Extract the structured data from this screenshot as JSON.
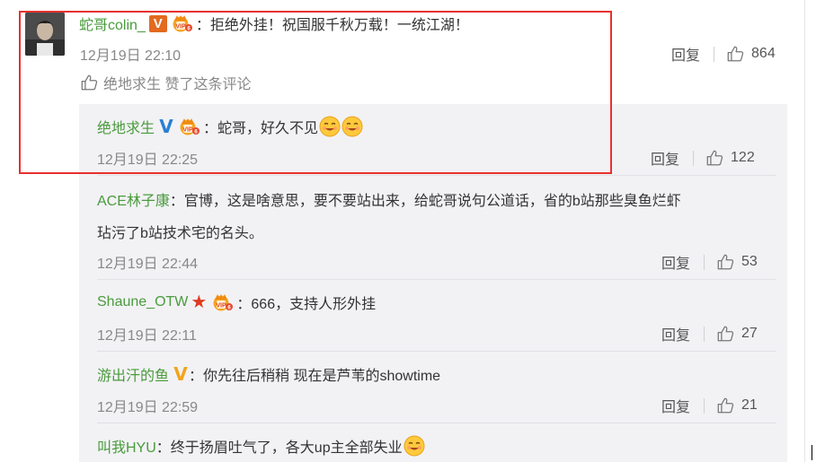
{
  "main_comment": {
    "username": "蛇哥colin_",
    "badge": "V",
    "badge_color": "#e36a1f",
    "text": "：拒绝外挂！祝国服千秋万载！一统江湖！",
    "time": "12月19日 22:10",
    "reply_label": "回复",
    "like_count": "864",
    "liked_by": "绝地求生 赞了这条评论"
  },
  "replies": [
    {
      "username": "绝地求生",
      "badge": "V",
      "badge_color": "#2a7fd4",
      "text": "：蛇哥，好久不见",
      "time": "12月19日 22:25",
      "reply_label": "回复",
      "like_count": "122"
    },
    {
      "username": "ACE林子康",
      "text": "：官博，这是啥意思，要不要站出来，给蛇哥说句公道话，省的b站那些臭鱼烂虾",
      "text_line2": "玷污了b站技术宅的名头。",
      "time": "12月19日 22:44",
      "reply_label": "回复",
      "like_count": "53"
    },
    {
      "username": "Shaune_OTW",
      "badge": "★",
      "badge_color": "#e03a1f",
      "text": "：666，支持人形外挂",
      "time": "12月19日 22:11",
      "reply_label": "回复",
      "like_count": "27"
    },
    {
      "username": "游出汗的鱼",
      "badge": "V",
      "badge_color": "#f2a41c",
      "text": "：你先往后稍稍 现在是芦苇的showtime",
      "time": "12月19日 22:59",
      "reply_label": "回复",
      "like_count": "21"
    },
    {
      "username": "叫我HYU",
      "text": "：终于扬眉吐气了，各大up主全部失业"
    }
  ],
  "colors": {
    "username": "#4a9b3c",
    "highlight_box": "#e8302e",
    "reply_bg": "#f2f2f5"
  }
}
